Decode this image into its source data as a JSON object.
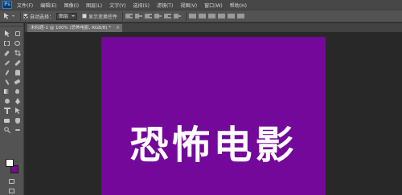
{
  "menubar": {
    "logo": "Ps",
    "items": [
      "文件(F)",
      "编辑(E)",
      "图像(I)",
      "图层(L)",
      "文字(Y)",
      "选择(S)",
      "滤镜(T)",
      "视图(V)",
      "窗口(W)",
      "帮助(H)"
    ]
  },
  "options": {
    "auto_select_label": "自动选择：",
    "auto_select_value": "图层",
    "show_transform_label": "显示变换控件"
  },
  "document": {
    "tab_title": "未标题-1 @ 100% (恐怖电影, RGB/8) *",
    "close_glyph": "×",
    "canvas_text": "恐怖电影",
    "canvas_color": "#74089a"
  },
  "colors": {
    "foreground": "#ffffff",
    "background": "#7a0c8c"
  }
}
